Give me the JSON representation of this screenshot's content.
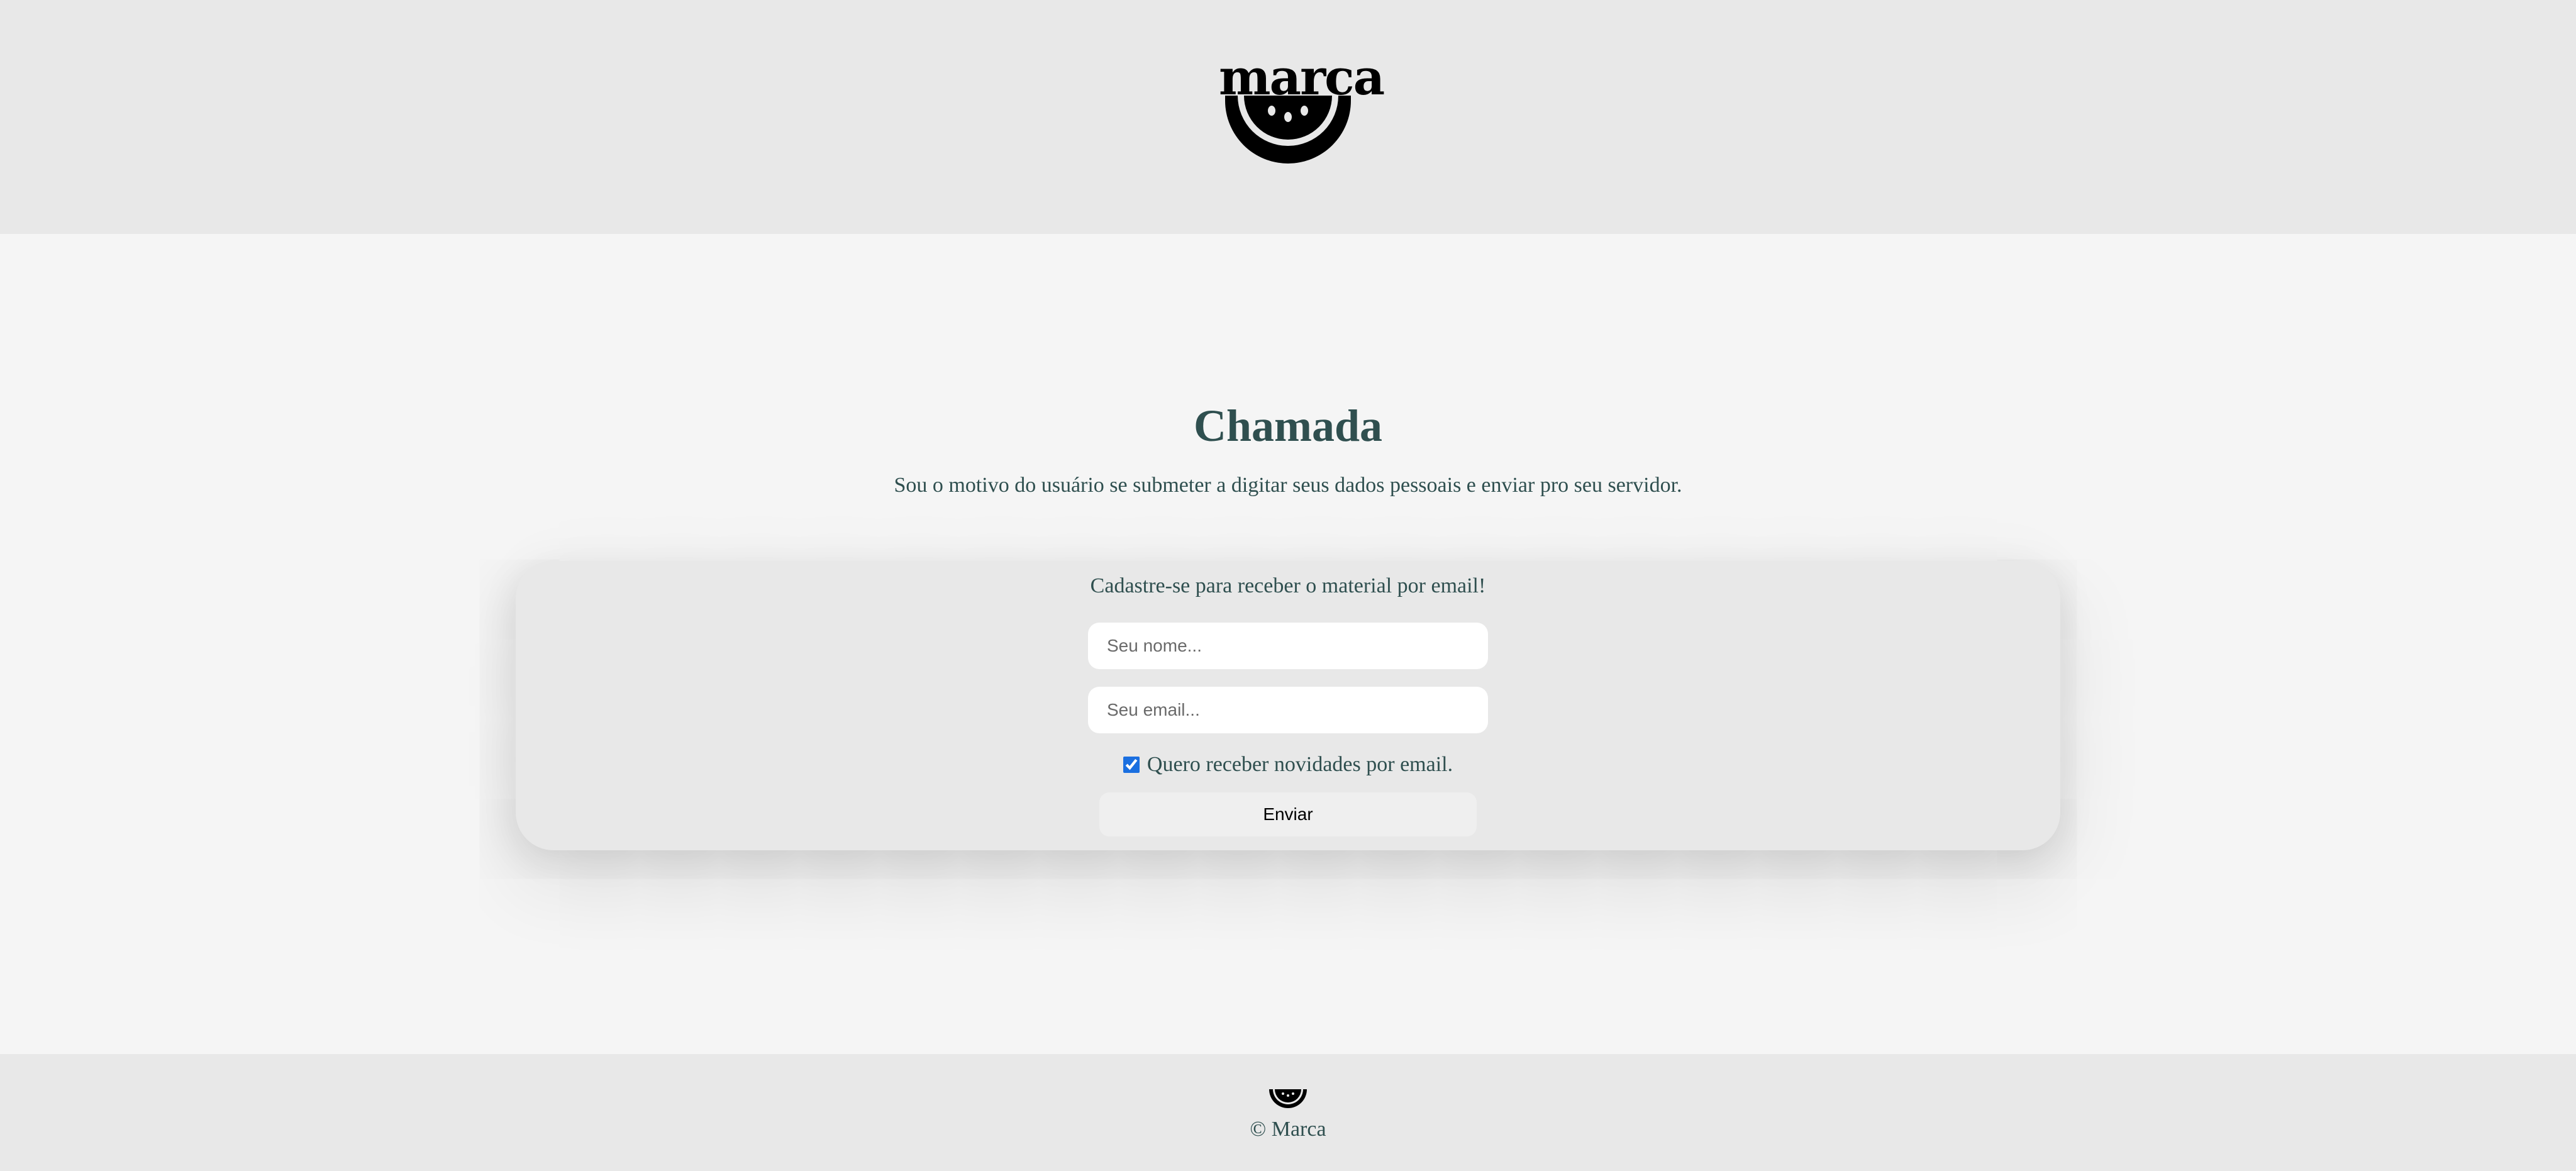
{
  "header": {
    "logo_text": "marca",
    "logo_icon": "watermelon-slice-icon"
  },
  "hero": {
    "title": "Chamada",
    "subtitle": "Sou o motivo do usuário se submeter a digitar seus dados pessoais e enviar pro seu servidor."
  },
  "form": {
    "title": "Cadastre-se para receber o material por email!",
    "name_placeholder": "Seu nome...",
    "name_value": "",
    "email_placeholder": "Seu email...",
    "email_value": "",
    "newsletter_label": "Quero receber novidades por email.",
    "newsletter_checked": true,
    "submit_label": "Enviar"
  },
  "footer": {
    "icon": "watermelon-slice-icon",
    "copyright": "© Marca"
  },
  "colors": {
    "header_bg": "#e8e8e8",
    "page_bg": "#f5f5f5",
    "text": "#2f4f4f",
    "checkbox_accent": "#1a6fe0"
  }
}
